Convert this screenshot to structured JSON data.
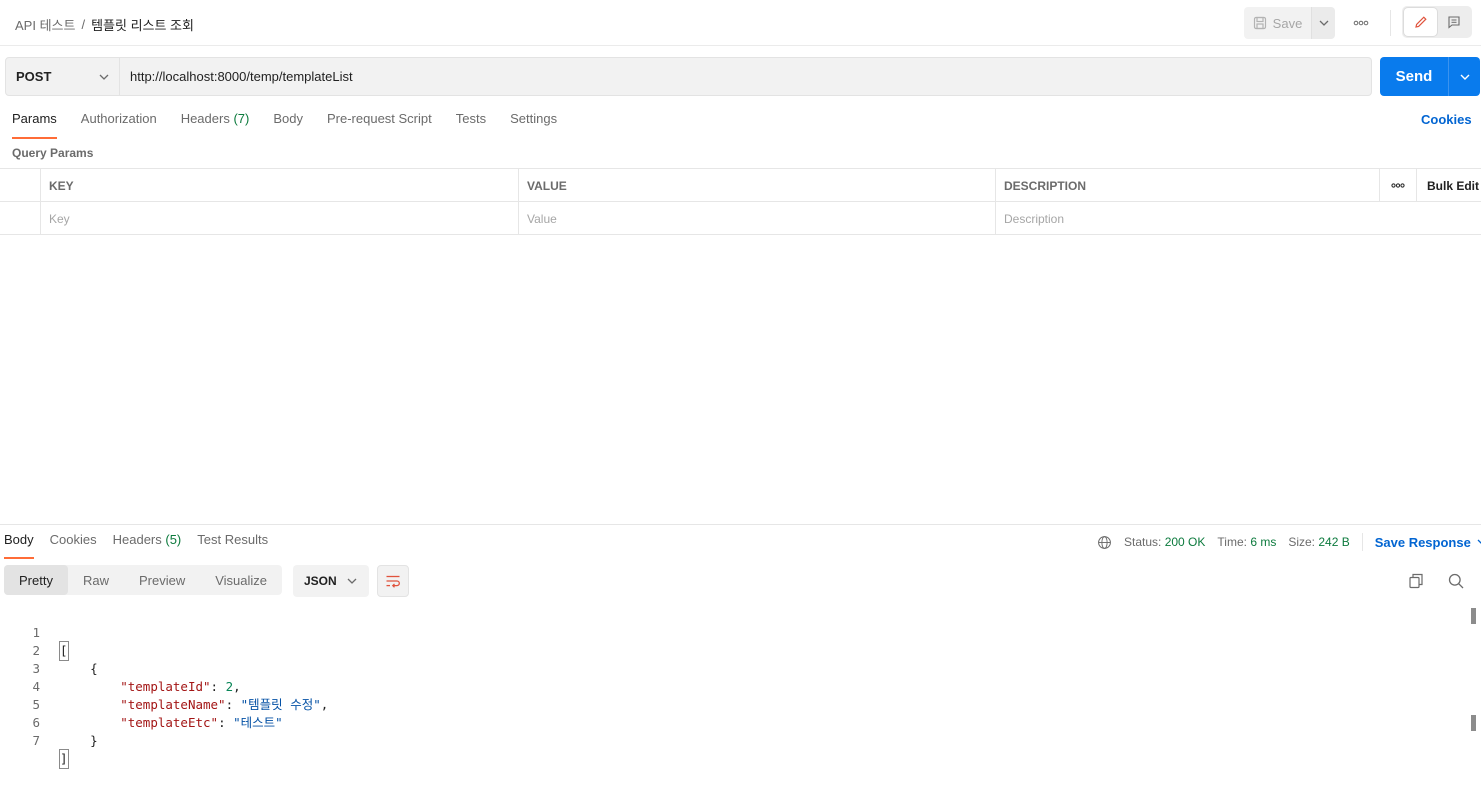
{
  "breadcrumb": {
    "parent": "API 테스트",
    "separator": "/",
    "current": "템플릿 리스트 조회"
  },
  "header": {
    "save_label": "Save"
  },
  "request": {
    "method": "POST",
    "url": "http://localhost:8000/temp/templateList",
    "send_label": "Send"
  },
  "req_tabs": [
    {
      "label": "Params"
    },
    {
      "label": "Authorization"
    },
    {
      "label": "Headers",
      "count": "(7)"
    },
    {
      "label": "Body"
    },
    {
      "label": "Pre-request Script"
    },
    {
      "label": "Tests"
    },
    {
      "label": "Settings"
    }
  ],
  "cookies_label": "Cookies",
  "query_params": {
    "title": "Query Params",
    "headers": {
      "key": "KEY",
      "value": "VALUE",
      "description": "DESCRIPTION",
      "bulk_edit": "Bulk Edit"
    },
    "placeholders": {
      "key": "Key",
      "value": "Value",
      "description": "Description"
    }
  },
  "response": {
    "tabs": [
      {
        "label": "Body"
      },
      {
        "label": "Cookies"
      },
      {
        "label": "Headers",
        "count": "(5)"
      },
      {
        "label": "Test Results"
      }
    ],
    "status_label": "Status:",
    "status_value": "200 OK",
    "time_label": "Time:",
    "time_value": "6 ms",
    "size_label": "Size:",
    "size_value": "242 B",
    "save_response": "Save Response",
    "view_modes": [
      "Pretty",
      "Raw",
      "Preview",
      "Visualize"
    ],
    "format": "JSON",
    "code": {
      "line_numbers": [
        "1",
        "2",
        "3",
        "4",
        "5",
        "6",
        "7"
      ],
      "l1": "[",
      "l2": "    {",
      "l3_key": "\"templateId\"",
      "l3_value": "2",
      "l4_key": "\"templateName\"",
      "l4_value": "\"템플릿 수정\"",
      "l5_key": "\"templateEtc\"",
      "l5_value": "\"테스트\"",
      "l6": "    }",
      "l7": "]"
    }
  },
  "colors": {
    "accent": "#ff6c37",
    "send": "#097bed",
    "link": "#0265d2",
    "success": "#0c7a3d"
  }
}
